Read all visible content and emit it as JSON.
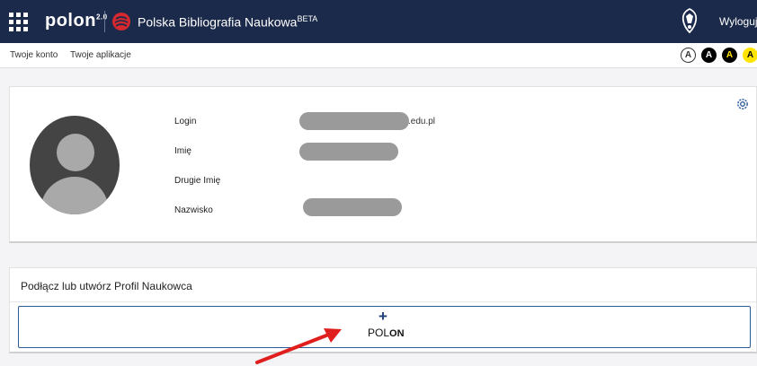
{
  "topbar": {
    "logo_text": "polon",
    "logo_version": "2.0",
    "app_title": "Polska Bibliografia Naukowa",
    "app_title_badge": "BETA",
    "logout_label": "Wyloguj"
  },
  "subbar": {
    "links": [
      "Twoje konto",
      "Twoje aplikacje"
    ],
    "contrast_modes": [
      "A",
      "A",
      "A",
      "A"
    ]
  },
  "profile": {
    "fields": [
      {
        "label": "Login",
        "value_visible": ".edu.pl"
      },
      {
        "label": "Imię",
        "value_visible": ""
      },
      {
        "label": "Drugie Imię",
        "value_visible": ""
      },
      {
        "label": "Nazwisko",
        "value_visible": ""
      }
    ]
  },
  "connect": {
    "title": "Podłącz lub utwórz Profil Naukowca",
    "button_plus": "+",
    "button_label_light": "POL",
    "button_label_bold": "ON"
  },
  "colors": {
    "topbar": "#1b2a4a",
    "accent_blue": "#2d5b9a",
    "pbn_red": "#d6282f",
    "arrow_red": "#e01e1e"
  }
}
